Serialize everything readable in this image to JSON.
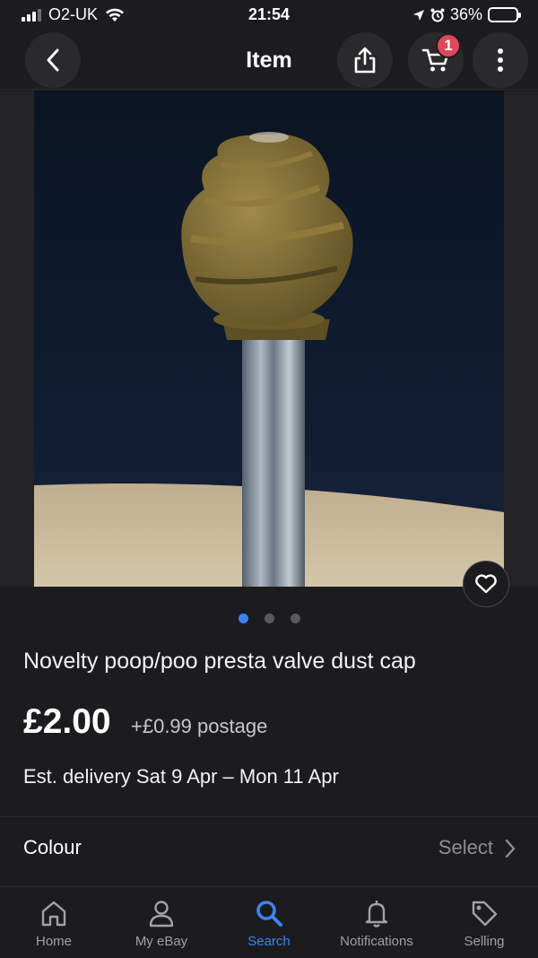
{
  "status_bar": {
    "carrier": "O2-UK",
    "time": "21:54",
    "battery": "36%",
    "battery_level": 0.36
  },
  "header": {
    "title": "Item",
    "cart_count": "1",
    "icons": [
      "back-arrow-icon",
      "share-icon",
      "cart-icon",
      "more-vertical-icon"
    ]
  },
  "gallery": {
    "image_count": 3,
    "active_index": 0
  },
  "listing": {
    "title": "Novelty poop/poo presta valve dust cap",
    "price": "£2.00",
    "postage": "+£0.99 postage",
    "delivery": "Est. delivery Sat 9 Apr – Mon 11 Apr"
  },
  "variation": {
    "label": "Colour",
    "action": "Select"
  },
  "tabs": [
    {
      "label": "Home",
      "icon": "home-icon"
    },
    {
      "label": "My eBay",
      "icon": "person-icon"
    },
    {
      "label": "Search",
      "icon": "search-icon",
      "active": true
    },
    {
      "label": "Notifications",
      "icon": "bell-icon"
    },
    {
      "label": "Selling",
      "icon": "tag-icon"
    }
  ],
  "colors": {
    "background": "#1c1c1e",
    "accent": "#3b82f6",
    "badge": "#e0475b"
  }
}
